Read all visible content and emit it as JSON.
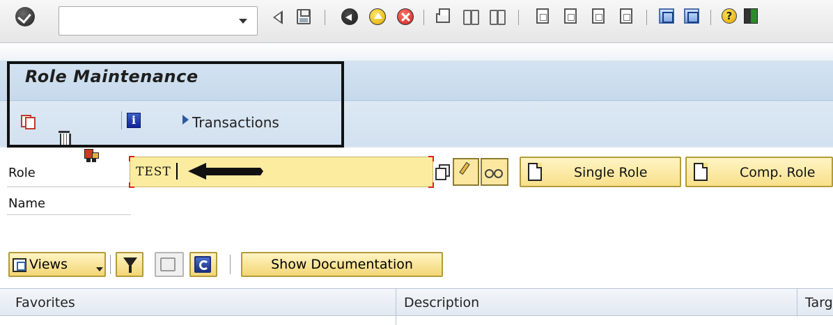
{
  "system_toolbar": {
    "command_field_value": "",
    "icons": [
      "enter-icon",
      "back-icon",
      "save-icon",
      "back-green-icon",
      "exit-icon",
      "cancel-icon",
      "print-icon",
      "find-icon",
      "find-next-icon",
      "first-page-icon",
      "previous-page-icon",
      "next-page-icon",
      "last-page-icon",
      "new-session-icon",
      "shortcut-icon",
      "help-icon",
      "layout-icon"
    ]
  },
  "title": {
    "text": "Role Maintenance"
  },
  "app_toolbar": {
    "transactions_label": "Transactions"
  },
  "form": {
    "role_label": "Role",
    "role_value": "TEST",
    "name_label": "Name",
    "single_role_label": "Single Role",
    "composite_role_label": "Comp. Role"
  },
  "tree_toolbar": {
    "views_label": "Views",
    "show_documentation_label": "Show Documentation"
  },
  "table": {
    "columns": [
      "Favorites",
      "Description",
      "Targ"
    ]
  },
  "colors": {
    "accent_band": "#d4e3f1",
    "input_yellow": "#fbeca0",
    "button_yellow": "#f8e08a",
    "highlight_border": "#111111"
  }
}
